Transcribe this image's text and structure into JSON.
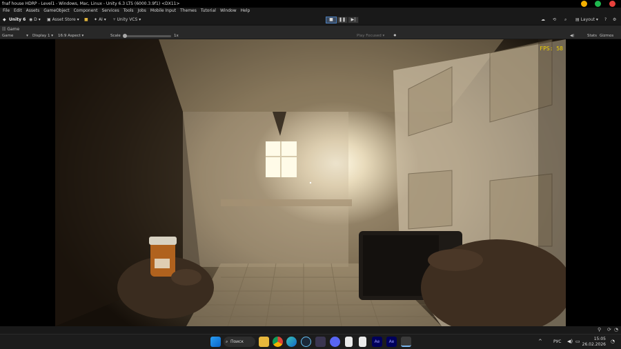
{
  "window": {
    "title": "fnaf house HDRP - Level1 - Windows, Mac, Linux - Unity 6.3 LTS (6000.3.9f1) <DX11>",
    "controls": {
      "minimize_color": "#f5b000",
      "maximize_color": "#1fb84f",
      "close_color": "#e8413c"
    }
  },
  "menu": [
    "File",
    "Edit",
    "Assets",
    "GameObject",
    "Component",
    "Services",
    "Tools",
    "Jobs",
    "Mobile Input",
    "Themes",
    "Tutorial",
    "Window",
    "Help"
  ],
  "toolbar": {
    "unity_label": "Unity 6",
    "account_label": "D",
    "asset_store_label": "Asset Store",
    "ai_label": "AI",
    "vcs_label": "Unity VCS",
    "layout_label": "Layout"
  },
  "tabs": {
    "game_tab": "Game"
  },
  "gamebar": {
    "view_mode": "Game",
    "display": "Display 1",
    "aspect": "16:9 Aspect",
    "scale_label": "Scale",
    "scale_value": "1x",
    "play_focused": "Play Focused",
    "stats": "Stats",
    "gizmos": "Gizmos"
  },
  "game": {
    "fps_text": "FPS: 58"
  },
  "taskbar": {
    "search_label": "Поиск",
    "lang": "РУС",
    "time": "15:05",
    "date": "26.02.2026",
    "icons": [
      "windows-start-icon",
      "search-icon",
      "file-explorer-icon",
      "chrome-icon",
      "edge-icon",
      "steam-icon",
      "affinity-icon",
      "discord-icon",
      "document-icon",
      "document-icon-2",
      "after-effects-icon",
      "after-effects-icon-2",
      "unity-hub-icon"
    ]
  },
  "colors": {
    "editor_bg": "#191919",
    "panel_bg": "#282828",
    "fps_color": "#f1d200"
  }
}
